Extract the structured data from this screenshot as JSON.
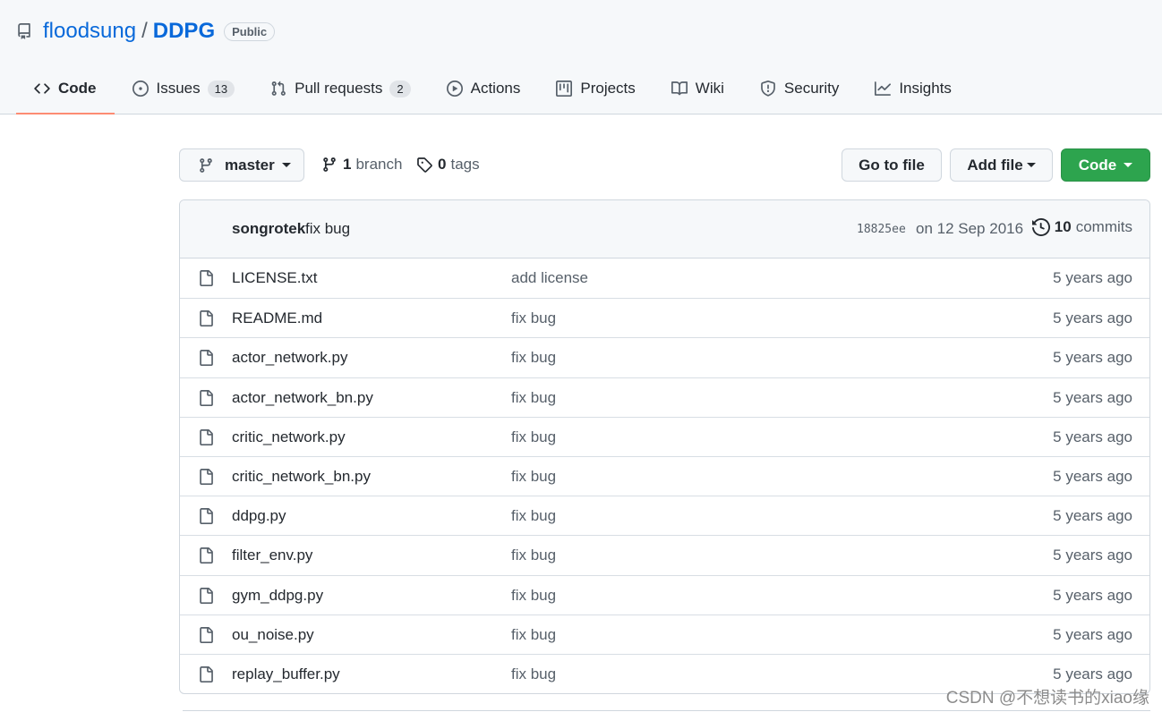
{
  "repo": {
    "owner": "floodsung",
    "separator": "/",
    "name": "DDPG",
    "visibility": "Public"
  },
  "tabs": [
    {
      "label": "Code",
      "icon": "code-icon",
      "active": true
    },
    {
      "label": "Issues",
      "icon": "issue-icon",
      "count": "13"
    },
    {
      "label": "Pull requests",
      "icon": "pull-request-icon",
      "count": "2"
    },
    {
      "label": "Actions",
      "icon": "play-icon"
    },
    {
      "label": "Projects",
      "icon": "project-icon"
    },
    {
      "label": "Wiki",
      "icon": "book-icon"
    },
    {
      "label": "Security",
      "icon": "shield-icon"
    },
    {
      "label": "Insights",
      "icon": "graph-icon"
    }
  ],
  "branch_bar": {
    "branch": "master",
    "branches_count": "1",
    "branches_label": "branch",
    "tags_count": "0",
    "tags_label": "tags",
    "go_to_file": "Go to file",
    "add_file": "Add file",
    "code": "Code"
  },
  "latest_commit": {
    "author": "songrotek",
    "message": "fix bug",
    "sha": "18825ee",
    "date": "on 12 Sep 2016",
    "commits_count": "10",
    "commits_label": "commits"
  },
  "files": [
    {
      "name": "LICENSE.txt",
      "message": "add license",
      "age": "5 years ago"
    },
    {
      "name": "README.md",
      "message": "fix bug",
      "age": "5 years ago"
    },
    {
      "name": "actor_network.py",
      "message": "fix bug",
      "age": "5 years ago"
    },
    {
      "name": "actor_network_bn.py",
      "message": "fix bug",
      "age": "5 years ago"
    },
    {
      "name": "critic_network.py",
      "message": "fix bug",
      "age": "5 years ago"
    },
    {
      "name": "critic_network_bn.py",
      "message": "fix bug",
      "age": "5 years ago"
    },
    {
      "name": "ddpg.py",
      "message": "fix bug",
      "age": "5 years ago"
    },
    {
      "name": "filter_env.py",
      "message": "fix bug",
      "age": "5 years ago"
    },
    {
      "name": "gym_ddpg.py",
      "message": "fix bug",
      "age": "5 years ago"
    },
    {
      "name": "ou_noise.py",
      "message": "fix bug",
      "age": "5 years ago"
    },
    {
      "name": "replay_buffer.py",
      "message": "fix bug",
      "age": "5 years ago"
    }
  ],
  "watermark": "CSDN @不想读书的xiao缘",
  "colors": {
    "link": "#0969da",
    "green_button": "#2da44e",
    "active_tab_underline": "#fd8c73"
  }
}
